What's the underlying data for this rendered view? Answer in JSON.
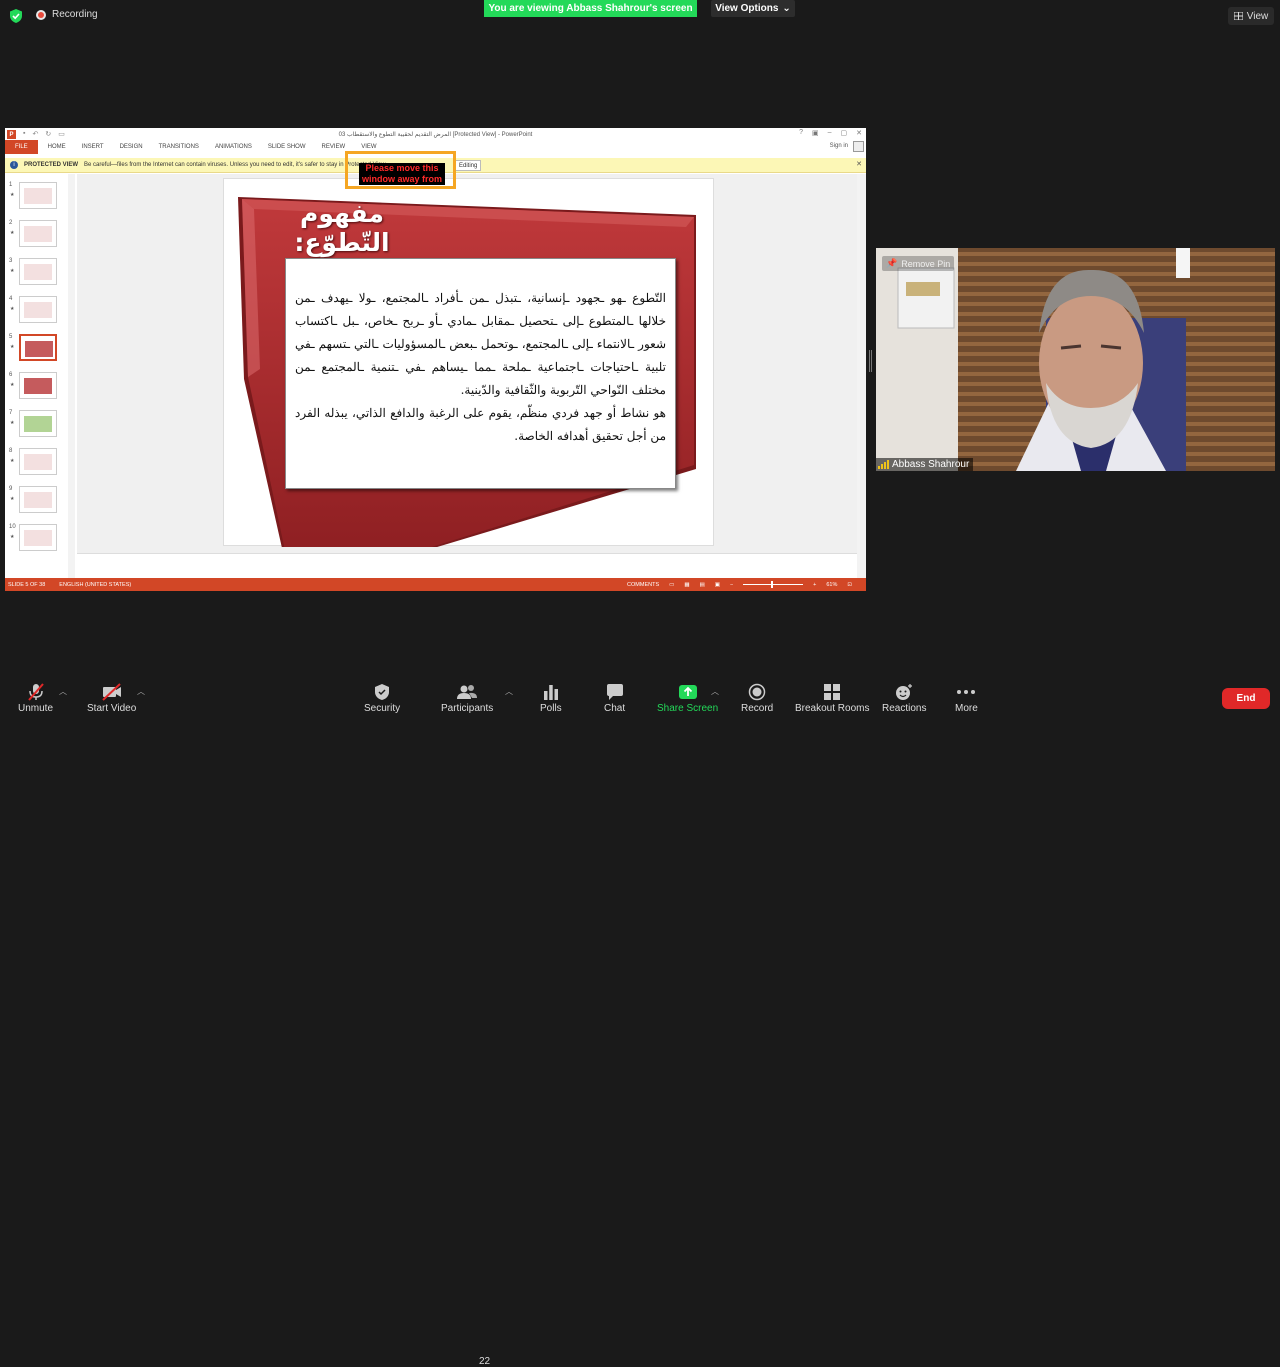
{
  "topbar": {
    "recording_label": "Recording",
    "viewing_banner": "You are viewing Abbass Shahrour's screen",
    "view_options_label": "View Options",
    "view_label": "View"
  },
  "ppt": {
    "window_title": "03 المرض التقديم لحقيبة التطوع والاستقطاب [Protected View] - PowerPoint",
    "tabs": [
      "FILE",
      "HOME",
      "INSERT",
      "DESIGN",
      "TRANSITIONS",
      "ANIMATIONS",
      "SLIDE SHOW",
      "REVIEW",
      "VIEW"
    ],
    "sign_in": "Sign in",
    "protected_view_title": "PROTECTED VIEW",
    "protected_view_msg": "Be careful—files from the Internet can contain viruses. Unless you need to edit, it's safer to stay in Protected View.",
    "enable_editing": "Editing",
    "move_notice": "Please move this window away from",
    "slide_title": "مفهوم التّطوّع:",
    "slide_para1": "التّطوع ـهو ـجهود ـإنسانية، ـتبذل ـمن ـأفراد ـالمجتمع، ـولا ـيهدف ـمن خلالها ـالمتطوع ـإلى ـتحصيل ـمقابل ـمادي ـأو ـربح ـخاص، ـبل ـاكتساب شعور ـالانتماء ـإلى ـالمجتمع، ـوتحمل ـبعض ـالمسؤوليات ـالتي ـتسهم ـفي تلبية ـاحتياجات ـاجتماعية ـملحة ـمما ـيساهم ـفي ـتنمية ـالمجتمع ـمن مختلف النّواحي التّربوية والثّقافية والدّينية.",
    "slide_para2": "هو نشاط أو جهد فردي منظّم، يقوم على الرغبة والدافع الذاتي، يبذله الفرد من أجل تحقيق أهدافه الخاصة.",
    "status_slide": "SLIDE 5 OF 38",
    "status_lang": "ENGLISH (UNITED STATES)",
    "status_comments": "COMMENTS",
    "status_zoom": "61%",
    "thumb_numbers": [
      "1",
      "2",
      "3",
      "4",
      "5",
      "6",
      "7",
      "8",
      "9",
      "10"
    ],
    "selected_slide": 5
  },
  "video": {
    "participant_name": "Abbass Shahrour",
    "remove_pin": "Remove Pin"
  },
  "toolbar": {
    "unmute": "Unmute",
    "start_video": "Start Video",
    "security": "Security",
    "participants": "Participants",
    "participants_count": "22",
    "polls": "Polls",
    "chat": "Chat",
    "share_screen": "Share Screen",
    "record": "Record",
    "breakout_rooms": "Breakout Rooms",
    "reactions": "Reactions",
    "more": "More",
    "end": "End"
  },
  "colors": {
    "zoom_green": "#23d959",
    "ppt_orange": "#d24726",
    "slide_red": "#a8282c",
    "end_red": "#e02828"
  }
}
